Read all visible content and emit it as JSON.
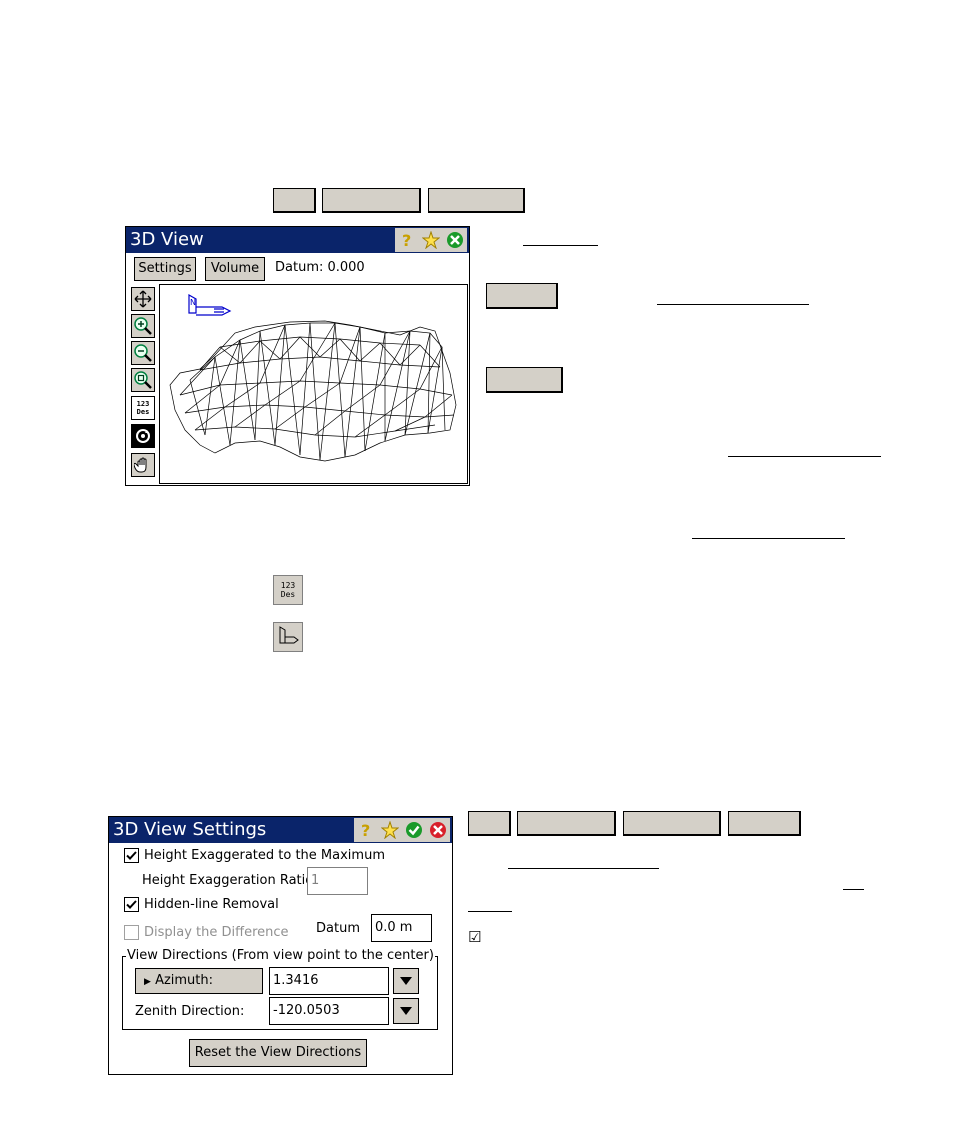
{
  "window1": {
    "title": "3D View",
    "settings_label": "Settings",
    "volume_label": "Volume",
    "datum_text": "Datum: 0.000",
    "north_label": "N",
    "tools": [
      "pan-icon",
      "zoom-in-icon",
      "zoom-out-icon",
      "zoom-extents-icon",
      "point-label-icon",
      "rotate-icon",
      "hand-icon"
    ],
    "tool4_text_top": "123",
    "tool4_text_bottom": "Des"
  },
  "window2": {
    "title": "3D View Settings",
    "height_exaggerated_label": "Height Exaggerated to the Maximum",
    "height_exaggerated_checked": true,
    "height_ratio_label": "Height Exaggeration Ratio",
    "height_ratio_value": "1",
    "hidden_line_label": "Hidden-line Removal",
    "hidden_line_checked": true,
    "display_difference_label": "Display the Difference",
    "display_difference_checked": false,
    "datum_label": "Datum",
    "datum_value": "0.0 m",
    "view_directions_label": "View Directions (From view point to the center)",
    "azimuth_label": "Azimuth:",
    "azimuth_value": "1.3416",
    "zenith_label": "Zenith Direction:",
    "zenith_value": "-120.0503",
    "reset_label": "Reset the View Directions"
  },
  "inline_icons": {
    "des_top": "123",
    "des_bottom": "Des"
  },
  "checkbox_glyph": "☑"
}
